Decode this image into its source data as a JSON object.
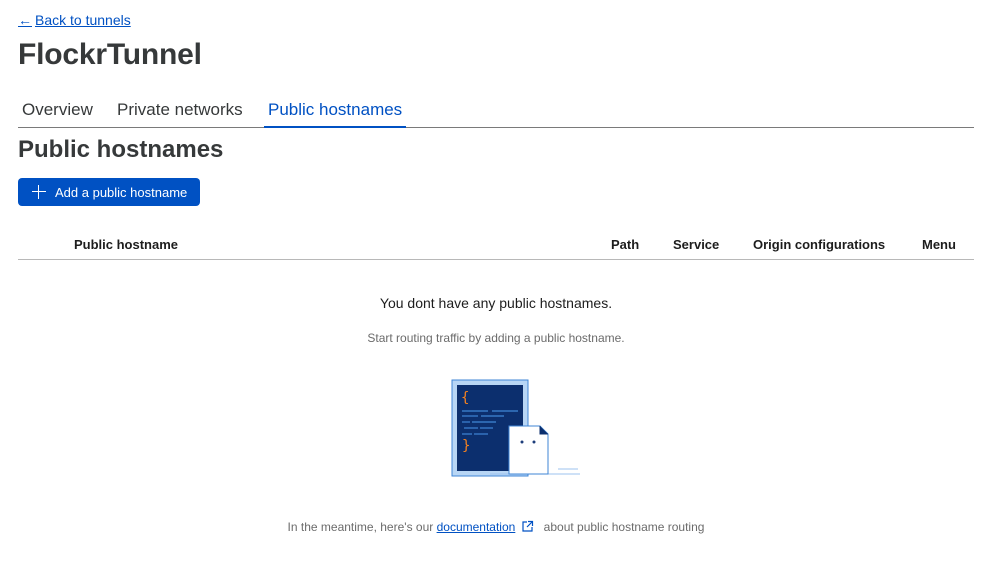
{
  "nav": {
    "back_label": "Back to tunnels",
    "back_arrow": "←"
  },
  "page": {
    "title": "FlockrTunnel"
  },
  "tabs": [
    {
      "label": "Overview",
      "active": false
    },
    {
      "label": "Private networks",
      "active": false
    },
    {
      "label": "Public hostnames",
      "active": true
    }
  ],
  "section": {
    "title": "Public hostnames",
    "add_button_label": "Add a public hostname"
  },
  "table": {
    "columns": [
      "Public hostname",
      "Path",
      "Service",
      "Origin configurations",
      "Menu"
    ]
  },
  "empty_state": {
    "title": "You dont have any public hostnames.",
    "subtitle": "Start routing traffic by adding a public hostname."
  },
  "footer": {
    "prefix": "In the meantime, here's our",
    "link_label": "documentation",
    "suffix": "about public hostname routing"
  },
  "colors": {
    "accent": "#0051c3",
    "illustration_navy": "#0c2f6e",
    "illustration_orange": "#f6821f"
  }
}
